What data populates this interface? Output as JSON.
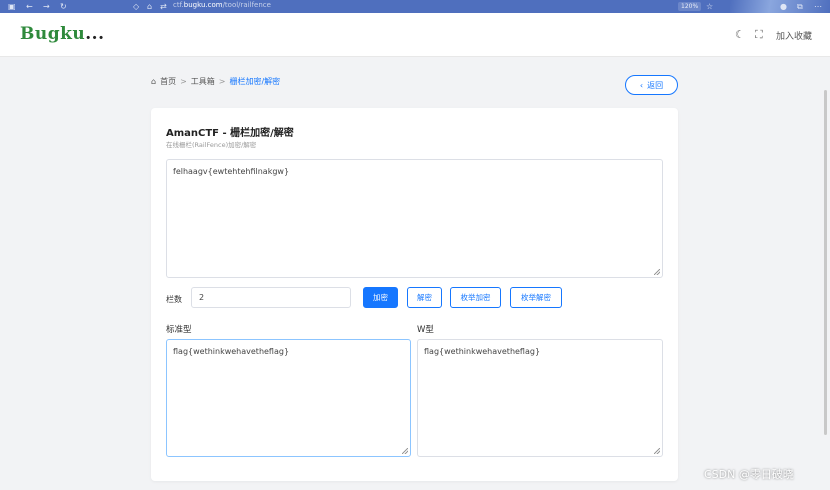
{
  "browser": {
    "url_prefix": "ctf.",
    "url_host": "bugku.com",
    "url_path": "/tool/railfence",
    "zoom": "120%"
  },
  "header": {
    "logo": "Bugku",
    "logo_suffix": "...",
    "favorite": "加入收藏"
  },
  "breadcrumb": {
    "home": "首页",
    "sep": ">",
    "tools": "工具箱",
    "current": "栅栏加密/解密"
  },
  "back_button": "返回",
  "card": {
    "title": "AmanCTF - 栅栏加密/解密",
    "subtitle": "在线栅栏(RailFence)加密/解密",
    "input_text": "felhaagv{ewtehtehfilnakgw}",
    "rails_label": "栏数",
    "rails_value": "2",
    "buttons": {
      "encrypt": "加密",
      "decrypt": "解密",
      "enum_encrypt": "枚举加密",
      "enum_decrypt": "枚举解密"
    },
    "standard_label": "标准型",
    "standard_output": "flag{wethinkwehavetheflag}",
    "w_label": "W型",
    "w_output": "flag{wethinkwehavetheflag}"
  },
  "watermark": "CSDN @零日破晓"
}
